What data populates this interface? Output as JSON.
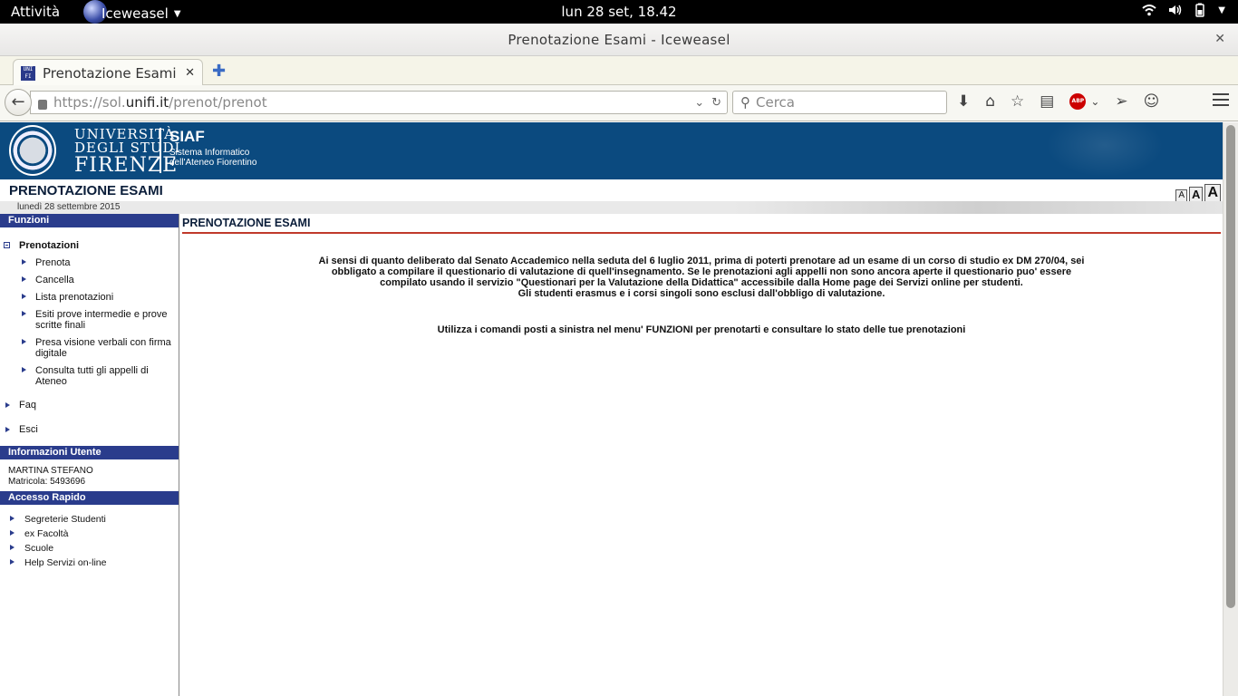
{
  "system_bar": {
    "activities": "Attività",
    "app_name": "Iceweasel",
    "clock": "lun 28 set, 18.42"
  },
  "window": {
    "title": "Prenotazione Esami - Iceweasel"
  },
  "tabs": [
    {
      "label": "Prenotazione Esami",
      "favicon_text": "UNI FI"
    }
  ],
  "navbar": {
    "url_prefix": "https://sol.",
    "url_domain": "unifi.it",
    "url_path": "/prenot/prenot",
    "search_placeholder": "Cerca",
    "adblock_label": "ABP"
  },
  "banner": {
    "university_line1": "UNIVERSITÀ",
    "university_line2": "DEGLI STUDI",
    "university_line3": "FIRENZE",
    "siaf_name": "SIAF",
    "siaf_sub1": "Sistema Informatico",
    "siaf_sub2": "dell'Ateneo Fiorentino",
    "brand_color": "#0b4a7f"
  },
  "header": {
    "app_title": "PRENOTAZIONE ESAMI",
    "date": "lunedì 28 settembre 2015",
    "font_size_buttons": [
      "A",
      "A",
      "A"
    ]
  },
  "sidebar": {
    "funzioni_title": "Funzioni",
    "prenotazioni_label": "Prenotazioni",
    "prenotazioni_items": [
      {
        "label": "Prenota"
      },
      {
        "label": "Cancella"
      },
      {
        "label": "Lista prenotazioni"
      },
      {
        "label": "Esiti prove intermedie e prove scritte finali"
      },
      {
        "label": "Presa visione verbali con firma digitale"
      },
      {
        "label": "Consulta tutti gli appelli di Ateneo"
      }
    ],
    "other_items": [
      {
        "label": "Faq"
      },
      {
        "label": "Esci"
      }
    ],
    "user_info_title": "Informazioni Utente",
    "user_name": "MARTINA STEFANO",
    "user_matricola": "Matricola: 5493696",
    "quick_access_title": "Accesso Rapido",
    "quick_items": [
      {
        "label": "Segreterie Studenti"
      },
      {
        "label": "ex Facoltà"
      },
      {
        "label": "Scuole"
      },
      {
        "label": "Help Servizi on-line"
      }
    ]
  },
  "main": {
    "title": "PRENOTAZIONE ESAMI",
    "notice_line1": "Ai sensi di quanto deliberato dal Senato Accademico nella seduta del 6 luglio 2011, prima di poterti prenotare ad un esame di un corso di studio ex DM 270/04, sei",
    "notice_line2": "obbligato a compilare il questionario di valutazione di quell'insegnamento. Se le prenotazioni agli appelli non sono ancora aperte il questionario puo' essere",
    "notice_line3": "compilato usando il servizio \"Questionari per la Valutazione della Didattica\" accessibile dalla Home page dei Servizi online per studenti.",
    "notice_line4": "Gli studenti erasmus e i corsi singoli sono esclusi dall'obbligo di valutazione.",
    "instructions": "Utilizza i comandi posti a sinistra nel menu' FUNZIONI per prenotarti e consultare lo stato delle tue prenotazioni",
    "accent_color": "#c0392b"
  }
}
